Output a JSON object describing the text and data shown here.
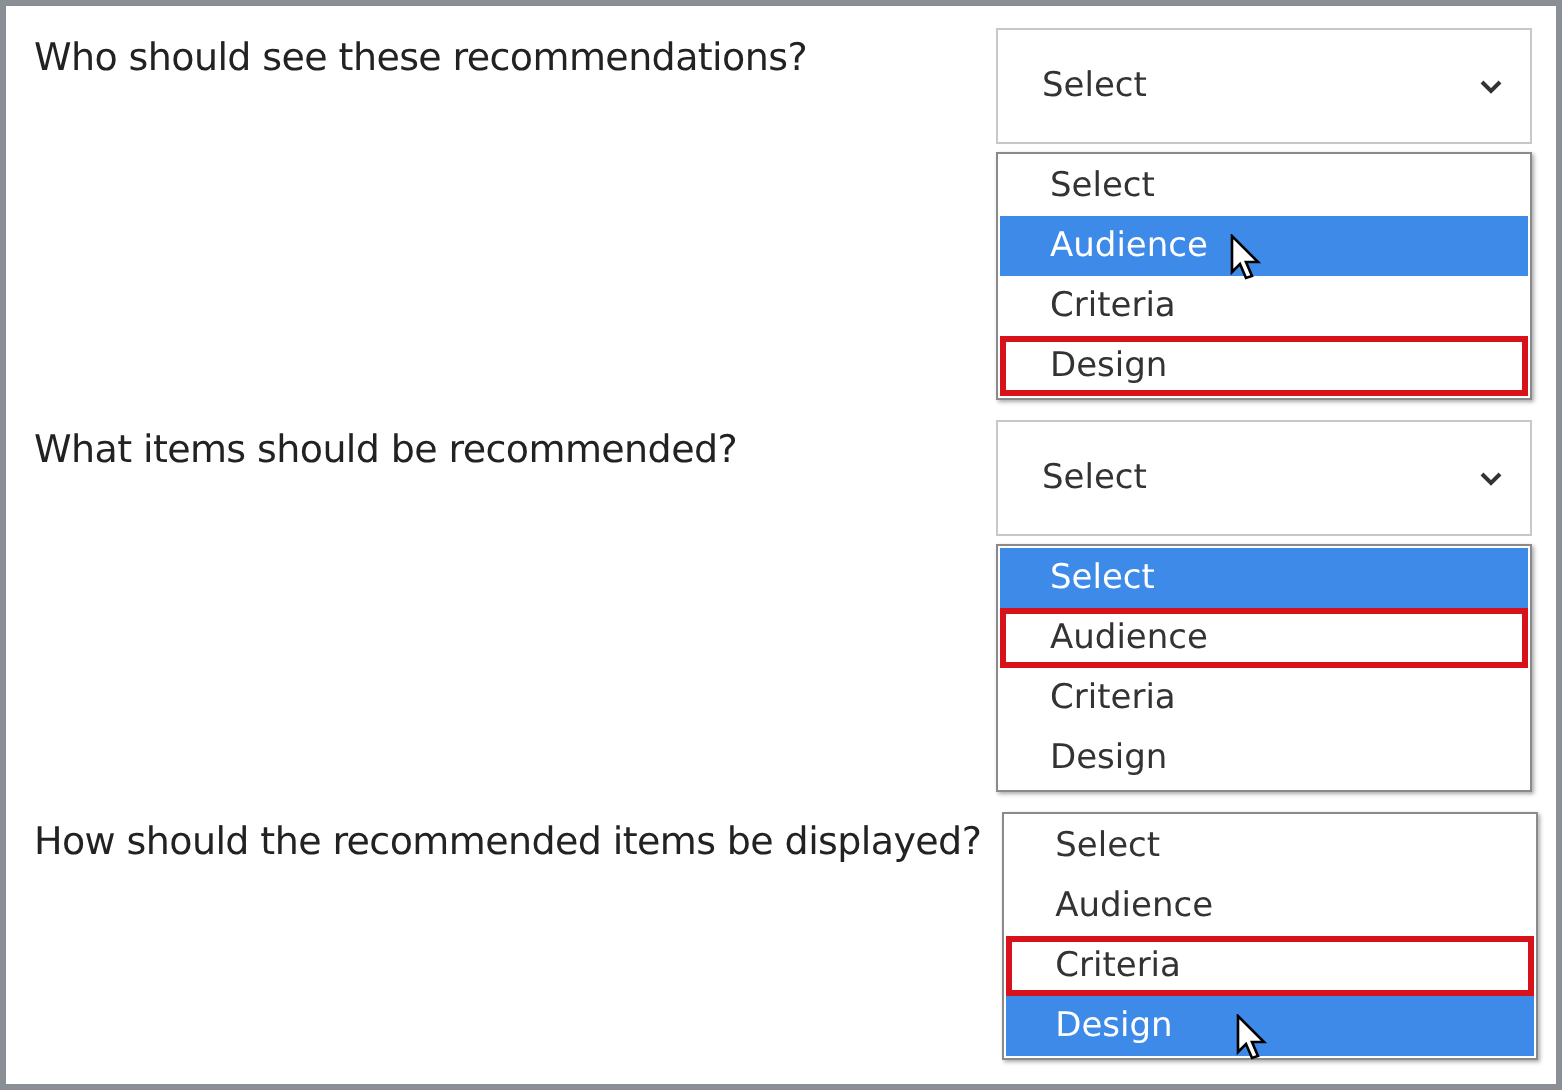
{
  "questions": [
    {
      "text": "Who should see these recommendations?",
      "dropdown": {
        "value": "Select"
      },
      "options": [
        {
          "label": "Select",
          "selected": false,
          "answer": false,
          "pointer": false
        },
        {
          "label": "Audience",
          "selected": true,
          "answer": false,
          "pointer": true
        },
        {
          "label": "Criteria",
          "selected": false,
          "answer": false,
          "pointer": false
        },
        {
          "label": "Design",
          "selected": false,
          "answer": true,
          "pointer": false
        }
      ]
    },
    {
      "text": "What items should be recommended?",
      "dropdown": {
        "value": "Select"
      },
      "options": [
        {
          "label": "Select",
          "selected": true,
          "answer": false,
          "pointer": false
        },
        {
          "label": "Audience",
          "selected": false,
          "answer": true,
          "pointer": false
        },
        {
          "label": "Criteria",
          "selected": false,
          "answer": false,
          "pointer": false
        },
        {
          "label": "Design",
          "selected": false,
          "answer": false,
          "pointer": false
        }
      ]
    },
    {
      "text": "How should the recommended items be displayed?",
      "options": [
        {
          "label": "Select",
          "selected": false,
          "answer": false,
          "pointer": false
        },
        {
          "label": "Audience",
          "selected": false,
          "answer": false,
          "pointer": false
        },
        {
          "label": "Criteria",
          "selected": false,
          "answer": true,
          "pointer": false
        },
        {
          "label": "Design",
          "selected": true,
          "answer": false,
          "pointer": true
        }
      ]
    }
  ]
}
